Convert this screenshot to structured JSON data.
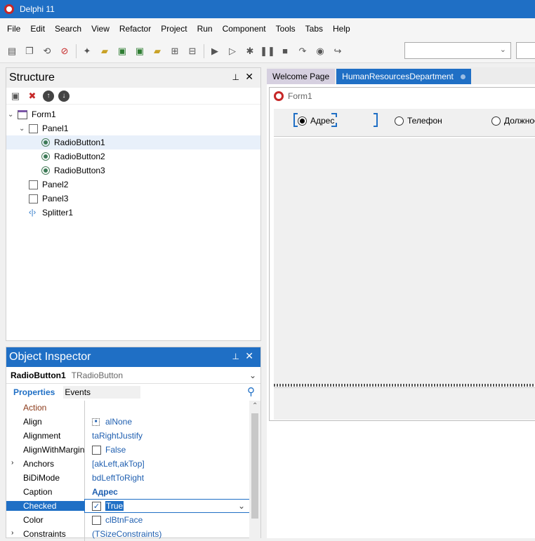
{
  "window": {
    "title": "Delphi 11"
  },
  "menu": [
    "File",
    "Edit",
    "Search",
    "View",
    "Refactor",
    "Project",
    "Run",
    "Component",
    "Tools",
    "Tabs",
    "Help"
  ],
  "structure": {
    "title": "Structure",
    "tree": [
      {
        "label": "Form1",
        "icon": "form-icon",
        "level": 0,
        "expanded": true
      },
      {
        "label": "Panel1",
        "icon": "panel-icon",
        "level": 1,
        "expanded": true
      },
      {
        "label": "RadioButton1",
        "icon": "radio-icon",
        "level": 2,
        "selected": true
      },
      {
        "label": "RadioButton2",
        "icon": "radio-icon",
        "level": 2
      },
      {
        "label": "RadioButton3",
        "icon": "radio-icon",
        "level": 2
      },
      {
        "label": "Panel2",
        "icon": "panel-icon",
        "level": 1
      },
      {
        "label": "Panel3",
        "icon": "panel-icon",
        "level": 1
      },
      {
        "label": "Splitter1",
        "icon": "splitter-icon",
        "level": 1
      }
    ]
  },
  "inspector": {
    "title": "Object Inspector",
    "object_name": "RadioButton1",
    "object_type": "TRadioButton",
    "tabs": {
      "properties": "Properties",
      "events": "Events"
    },
    "properties": [
      {
        "name": "Action",
        "value": "",
        "style": "action"
      },
      {
        "name": "Align",
        "value": "alNone",
        "icon": "align-icon"
      },
      {
        "name": "Alignment",
        "value": "taRightJustify"
      },
      {
        "name": "AlignWithMargin",
        "value": "False",
        "checkbox": true
      },
      {
        "name": "Anchors",
        "value": "[akLeft,akTop]",
        "expandable": true
      },
      {
        "name": "BiDiMode",
        "value": "bdLeftToRight"
      },
      {
        "name": "Caption",
        "value": "Адрес",
        "bold": true
      },
      {
        "name": "Checked",
        "value": "True",
        "checkbox": true,
        "checked": true,
        "selected": true
      },
      {
        "name": "Color",
        "value": "clBtnFace",
        "swatch": true
      },
      {
        "name": "Constraints",
        "value": "(TSizeConstraints)",
        "expandable": true
      }
    ]
  },
  "editor": {
    "tabs": [
      {
        "label": "Welcome Page"
      },
      {
        "label": "HumanResourcesDepartment",
        "active": true
      }
    ],
    "form_caption": "Form1",
    "radio_buttons": [
      {
        "label": "Адрес",
        "checked": true
      },
      {
        "label": "Телефон",
        "checked": false
      },
      {
        "label": "Должност",
        "checked": false
      }
    ]
  }
}
